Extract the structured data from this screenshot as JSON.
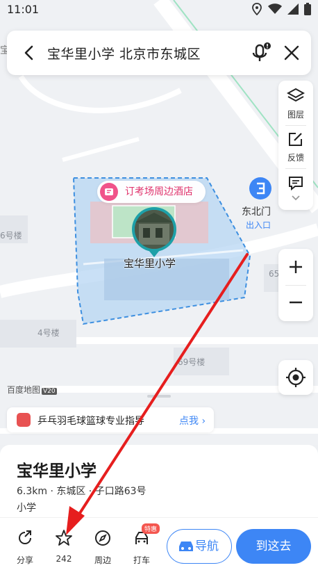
{
  "status_bar": {
    "time": "11:01"
  },
  "search": {
    "query": "宝华里小学 北京市东城区"
  },
  "tools": {
    "layers_label": "图层",
    "feedback_label": "反馈"
  },
  "map": {
    "building_labels": [
      "6号楼",
      "4号楼",
      "65",
      "69号楼"
    ],
    "hotel_tag": "订考场周边酒店",
    "poi_name": "宝华里小学",
    "gate_name": "东北门",
    "gate_sub": "出入口",
    "logo_text": "百度地图",
    "logo_version": "V20",
    "left_edge_text": "宝"
  },
  "banner": {
    "text": "乒乓羽毛球篮球专业指导",
    "link": "点我"
  },
  "poi": {
    "title": "宝华里小学",
    "address": "6.3km · 东城区 · 子口路63号",
    "category": "小学"
  },
  "actions": {
    "share": "分享",
    "favorite_count": "242",
    "nearby": "周边",
    "taxi": "打车",
    "taxi_badge": "特惠",
    "navigate": "导航",
    "go_here": "到这去"
  },
  "colors": {
    "accent": "#3d86f5",
    "area_fill": "#b7d5f3",
    "pink": "#e0306a",
    "arrow": "#e61e1e"
  }
}
